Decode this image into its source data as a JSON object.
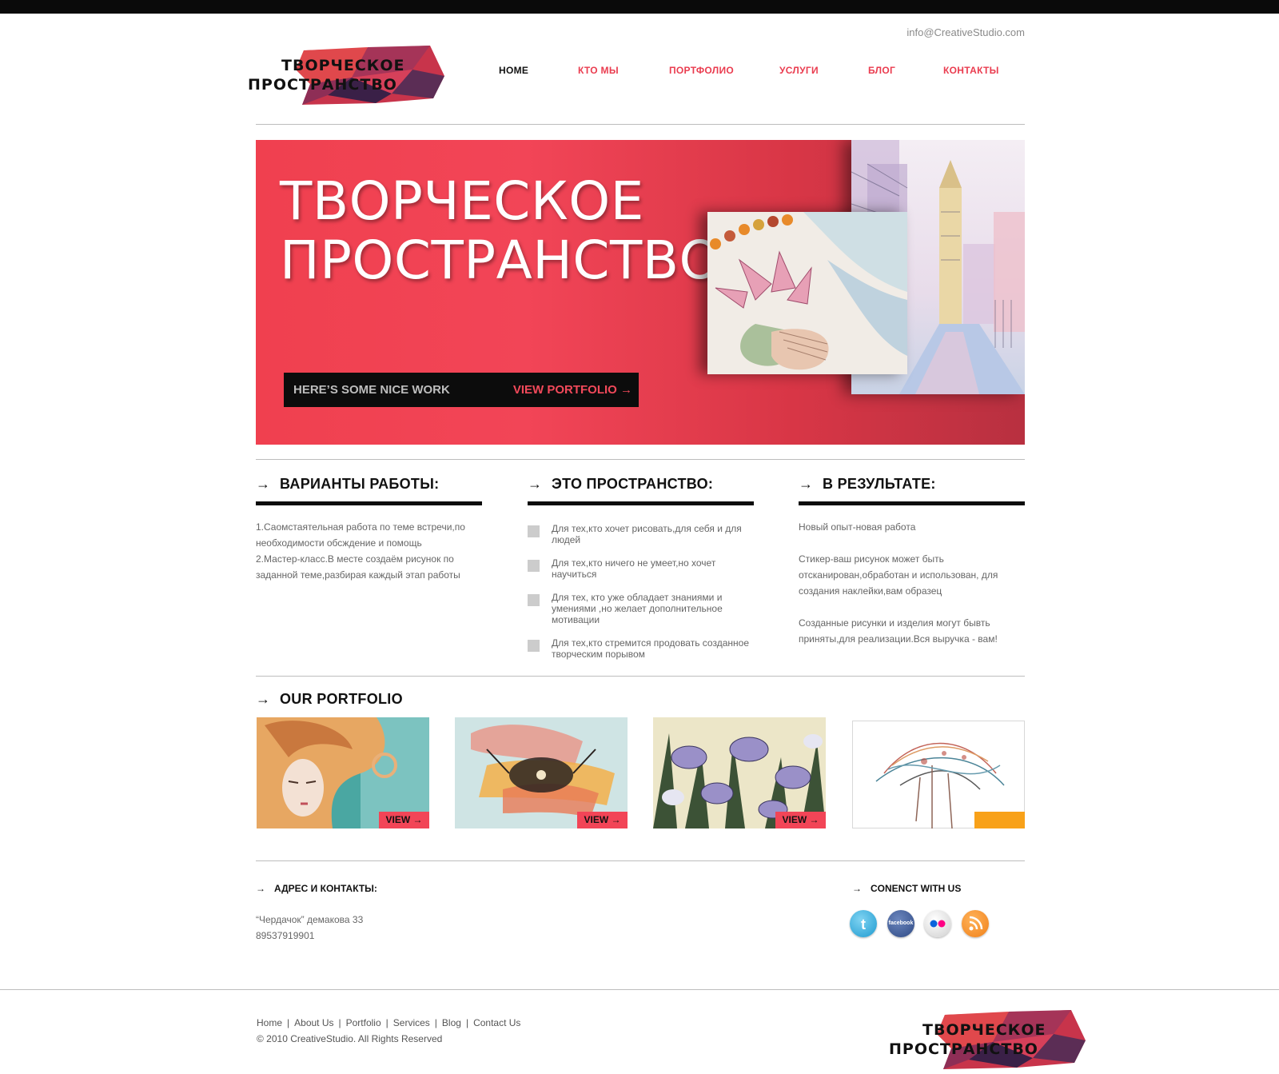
{
  "header": {
    "email": "info@CreativeStudio.com",
    "logo": {
      "line1": "ТВОРЧЕСКОЕ",
      "line2": "ПРОСТРАНСТВО"
    }
  },
  "nav": {
    "items": [
      {
        "label": "HOME",
        "active": true
      },
      {
        "label": "КТО МЫ",
        "active": false
      },
      {
        "label": "ПОРТФОЛИО",
        "active": false
      },
      {
        "label": "УСЛУГИ",
        "active": false
      },
      {
        "label": "БЛОГ",
        "active": false
      },
      {
        "label": "КОНТАКТЫ",
        "active": false
      }
    ]
  },
  "hero": {
    "title_line1": "ТВОРЧЕСКОЕ",
    "title_line2": "ПРОСТРАНСТВО",
    "cta_label": "HERE’S SOME NICE WORK",
    "cta_link": "VIEW PORTFOLIO →"
  },
  "columns": [
    {
      "heading": "ВАРИАНТЫ РАБОТЫ:",
      "paragraphs": [
        "1.Саомстаятельная работа по теме встречи,по необходимости обсждение и помощь",
        "2.Мастер-класс.В месте создаём рисунок по заданной теме,разбирая каждый этап работы"
      ]
    },
    {
      "heading": "ЭТО ПРОСТРАНСТВО:",
      "bullets": [
        "Для тех,кто хочет рисовать,для себя и для людей",
        "Для тех,кто ничего не умеет,но хочет научиться",
        "Для тех, кто уже обладает знаниями и умениями ,но желает дополнительное мотивации",
        "Для тех,кто стремится продовать созданное творческим порывом"
      ]
    },
    {
      "heading": "В РЕЗУЛЬТАТЕ:",
      "paragraphs": [
        "Новый опыт-новая работа",
        "Стикер-ваш рисунок может быть отсканирован,обработан и использован, для создания наклейки,вам образец",
        "Созданные рисунки и изделия могут бывть приняты,для реализации.Вся выручка - вам!"
      ]
    }
  ],
  "portfolio": {
    "title": "OUR PORTFOLIO",
    "view_label": "VIEW →"
  },
  "contacts": {
    "heading": "АДРЕС И КОНТАКТЫ:",
    "address": "“Чердачок” демакова 33",
    "phone": "89537919901"
  },
  "social": {
    "heading": "CONENCT WITH US",
    "icons": [
      "twitter-icon",
      "facebook-icon",
      "flickr-icon",
      "rss-icon"
    ],
    "facebook_text": "facebook"
  },
  "footer": {
    "links": [
      "Home",
      "About Us",
      "Portfolio",
      "Services",
      "Blog",
      "Contact Us"
    ],
    "copyright": "© 2010 CreativeStudio. All Rights Reserved"
  },
  "colors": {
    "accent": "#f24557",
    "dark": "#0c0c0c",
    "orange": "#f8a119"
  }
}
